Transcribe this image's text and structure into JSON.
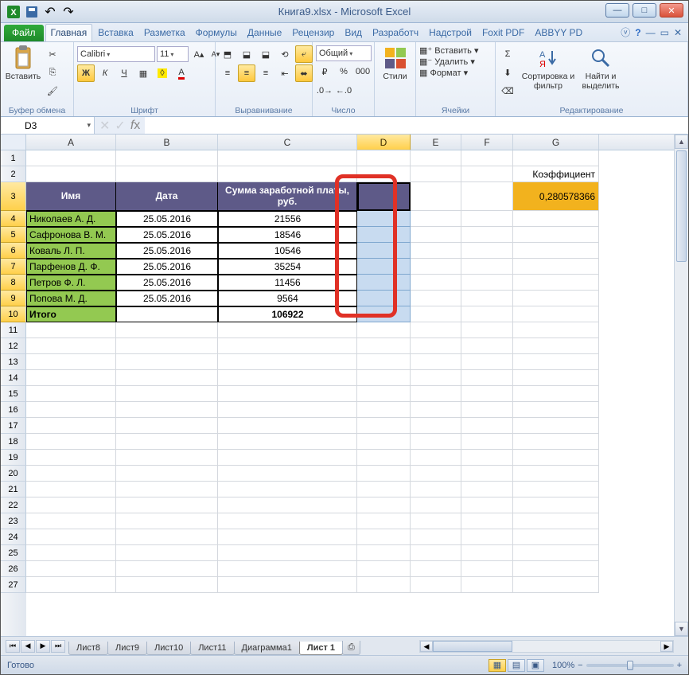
{
  "window": {
    "title_file": "Книга9.xlsx",
    "title_app": "Microsoft Excel"
  },
  "ribbon": {
    "file": "Файл",
    "tabs": [
      "Главная",
      "Вставка",
      "Разметка",
      "Формулы",
      "Данные",
      "Рецензир",
      "Вид",
      "Разработч",
      "Надстрой",
      "Foxit PDF",
      "ABBYY PD"
    ],
    "active": 0,
    "groups": {
      "clipboard": "Буфер обмена",
      "paste": "Вставить",
      "font": "Шрифт",
      "font_name": "Calibri",
      "font_size": "11",
      "align": "Выравнивание",
      "number": "Число",
      "number_fmt": "Общий",
      "styles": "Стили",
      "styles_btn": "Стили",
      "cells": "Ячейки",
      "insert": "Вставить",
      "delete": "Удалить",
      "format": "Формат",
      "editing": "Редактирование",
      "sort": "Сортировка и фильтр",
      "find": "Найти и выделить"
    }
  },
  "namebox": "D3",
  "columns": [
    "A",
    "B",
    "C",
    "D",
    "E",
    "F",
    "G"
  ],
  "rows_tall": [
    3
  ],
  "coef": {
    "label": "Коэффициент",
    "value": "0,280578366"
  },
  "table": {
    "headers": [
      "Имя",
      "Дата",
      "Сумма заработной платы, руб."
    ],
    "rows": [
      {
        "name": "Николаев А. Д.",
        "date": "25.05.2016",
        "sum": "21556"
      },
      {
        "name": "Сафронова В. М.",
        "date": "25.05.2016",
        "sum": "18546"
      },
      {
        "name": "Коваль Л. П.",
        "date": "25.05.2016",
        "sum": "10546"
      },
      {
        "name": "Парфенов Д. Ф.",
        "date": "25.05.2016",
        "sum": "35254"
      },
      {
        "name": "Петров Ф. Л.",
        "date": "25.05.2016",
        "sum": "11456"
      },
      {
        "name": "Попова М. Д.",
        "date": "25.05.2016",
        "sum": "9564"
      }
    ],
    "total": {
      "label": "Итого",
      "sum": "106922"
    }
  },
  "sheets": [
    "Лист8",
    "Лист9",
    "Лист10",
    "Лист11",
    "Диаграмма1",
    "Лист 1"
  ],
  "active_sheet": 5,
  "status": {
    "ready": "Готово",
    "zoom": "100%"
  }
}
